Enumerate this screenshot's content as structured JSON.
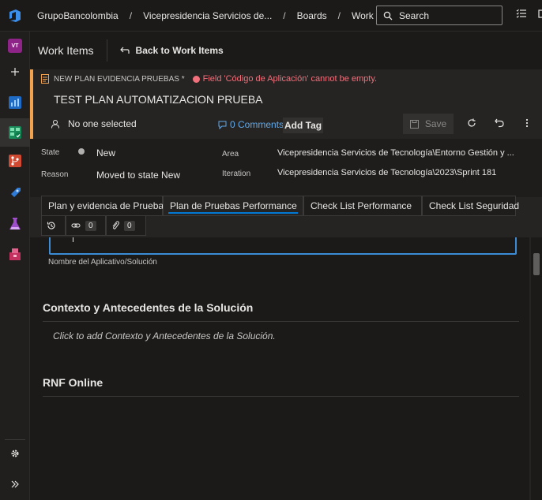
{
  "topbar": {
    "breadcrumbs": [
      "GrupoBancolombia",
      "Vicepresidencia Servicios de...",
      "Boards",
      "Work items"
    ],
    "search_placeholder": "Search",
    "logo_icon": "azure-devops-logo-icon"
  },
  "rail": {
    "avatar_initials": "VT",
    "items": [
      "add-icon",
      "overview-icon",
      "boards-icon",
      "repos-icon",
      "pipelines-icon",
      "test-plans-icon",
      "artifacts-icon"
    ],
    "settings_icon": "gear-icon",
    "expand_icon": "double-chevron-right-icon"
  },
  "header": {
    "title": "Work Items",
    "back_label": "Back to Work Items"
  },
  "workitem": {
    "type_label": "NEW PLAN EVIDENCIA PRUEBAS *",
    "error_message": "Field 'Código de Aplicación' cannot be empty.",
    "title": "TEST PLAN AUTOMATIZACION PRUEBA",
    "assigned": "No one selected",
    "comments": "0 Comments",
    "add_tag": "Add Tag",
    "save": "Save"
  },
  "fields": {
    "state_label": "State",
    "state_value": "New",
    "reason_label": "Reason",
    "reason_value": "Moved to state New",
    "area_label": "Area",
    "area_value": "Vicepresidencia Servicios de Tecnología\\Entorno Gestión y ...",
    "iteration_label": "Iteration",
    "iteration_value": "Vicepresidencia Servicios de Tecnología\\2023\\Sprint 181"
  },
  "tabs": [
    {
      "label": "Plan y evidencia de Pruebas",
      "error": false
    },
    {
      "label": "Plan de Pruebas Performance",
      "error": true,
      "active": true
    },
    {
      "label": "Check List Performance",
      "error": true
    },
    {
      "label": "Check List Seguridad",
      "error": false
    }
  ],
  "subtabs": {
    "links_count": "0",
    "attachments_count": "0"
  },
  "content": {
    "field_label": "Nombre del Aplicativo/Solución",
    "section1_title": "Contexto y Antecedentes de la Solución",
    "section1_placeholder": "Click to add Contexto y Antecedentes de la Solución.",
    "section2_title": "RNF Online"
  },
  "colors": {
    "accent": "#0078d4",
    "error": "#f1707b",
    "workitem_type": "#f2a24d"
  }
}
